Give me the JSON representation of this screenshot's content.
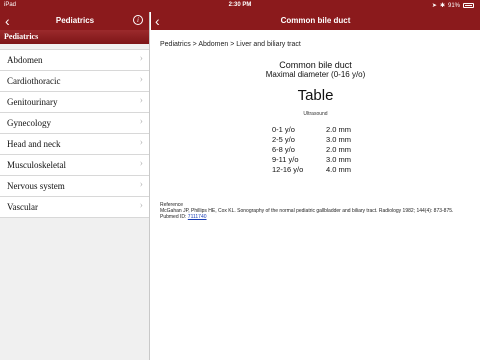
{
  "status_bar": {
    "carrier": "iPad",
    "time": "2:30 PM",
    "battery_percent": "91%",
    "battery_level": 0.91
  },
  "sidebar": {
    "nav_title": "Pediatrics",
    "section_header": "Pediatrics",
    "items": [
      {
        "label": "Abdomen"
      },
      {
        "label": "Cardiothoracic"
      },
      {
        "label": "Genitourinary"
      },
      {
        "label": "Gynecology"
      },
      {
        "label": "Head and neck"
      },
      {
        "label": "Musculoskeletal"
      },
      {
        "label": "Nervous system"
      },
      {
        "label": "Vascular"
      }
    ]
  },
  "detail": {
    "nav_title": "Common bile duct",
    "breadcrumb": "Pediatrics > Abdomen > Liver and biliary tract",
    "title": "Common bile duct",
    "subtitle": "Maximal diameter (0-16 y/o)",
    "table_heading": "Table",
    "method": "Ultrasound",
    "rows": [
      {
        "age": "0-1 y/o",
        "value": "2.0 mm"
      },
      {
        "age": "2-5 y/o",
        "value": "3.0 mm"
      },
      {
        "age": "6-8 y/o",
        "value": "2.0 mm"
      },
      {
        "age": "9-11 y/o",
        "value": "3.0 mm"
      },
      {
        "age": "12-16 y/o",
        "value": "4.0 mm"
      }
    ],
    "reference_label": "Reference",
    "reference_text": "McGahan JP, Phillips HE, Cox KL. Sonography of the normal pediatric gallbladder and biliary tract. Radiology 1982; 144(4): 873-875.",
    "pubmed_label": "Pubmed ID:",
    "pubmed_id": "7111740"
  },
  "colors": {
    "brand": "#8b1a1c",
    "link": "#1a3fb5"
  }
}
